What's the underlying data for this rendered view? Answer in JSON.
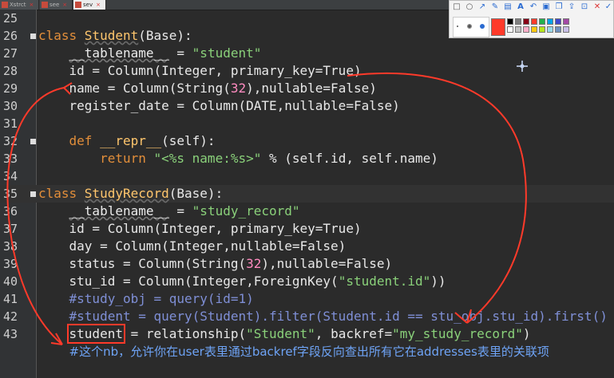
{
  "tabs": [
    {
      "label": "Xstrct"
    },
    {
      "label": "see"
    },
    {
      "label": "sev"
    }
  ],
  "lines": [
    {
      "n": "25",
      "tokens": []
    },
    {
      "n": "26",
      "fold": true,
      "tokens": [
        [
          "kw",
          "class "
        ],
        [
          "cls under",
          "Student"
        ],
        [
          "w",
          "(Base):"
        ]
      ]
    },
    {
      "n": "27",
      "tokens": [
        [
          "w",
          "    "
        ],
        [
          "tbl",
          "__tablename__"
        ],
        [
          "w",
          " = "
        ],
        [
          "str",
          "\"student\""
        ]
      ]
    },
    {
      "n": "28",
      "tokens": [
        [
          "w",
          "    id = Column(Integer, primary_key=True)"
        ]
      ]
    },
    {
      "n": "29",
      "tokens": [
        [
          "w",
          "    name = Column(String("
        ],
        [
          "num32",
          "32"
        ],
        [
          "w",
          "),nullable=False)"
        ]
      ]
    },
    {
      "n": "30",
      "tokens": [
        [
          "w",
          "    register_date = Column(DATE,nullable=False)"
        ]
      ]
    },
    {
      "n": "31",
      "tokens": []
    },
    {
      "n": "32",
      "fold": true,
      "tokens": [
        [
          "w",
          "    "
        ],
        [
          "kw",
          "def "
        ],
        [
          "cls",
          "__repr__"
        ],
        [
          "w",
          "(self):"
        ]
      ]
    },
    {
      "n": "33",
      "tokens": [
        [
          "w",
          "        "
        ],
        [
          "kw",
          "return "
        ],
        [
          "str",
          "\"<%s name:%s>\""
        ],
        [
          "w",
          " % (self.id, self.name)"
        ]
      ]
    },
    {
      "n": "34",
      "tokens": []
    },
    {
      "n": "35",
      "fold": true,
      "hl": true,
      "tokens": [
        [
          "kw",
          "class "
        ],
        [
          "cls under",
          "StudyRecord"
        ],
        [
          "w",
          "(Base):"
        ]
      ]
    },
    {
      "n": "36",
      "tokens": [
        [
          "w",
          "    "
        ],
        [
          "tbl",
          "__tablename__"
        ],
        [
          "w",
          " = "
        ],
        [
          "str",
          "\"study_record\""
        ]
      ]
    },
    {
      "n": "37",
      "tokens": [
        [
          "w",
          "    id = Column(Integer, primary_key=True)"
        ]
      ]
    },
    {
      "n": "38",
      "tokens": [
        [
          "w",
          "    day = Column(Integer,nullable=False)"
        ]
      ]
    },
    {
      "n": "39",
      "tokens": [
        [
          "w",
          "    status = Column(String("
        ],
        [
          "num32",
          "32"
        ],
        [
          "w",
          "),nullable=False)"
        ]
      ]
    },
    {
      "n": "40",
      "tokens": [
        [
          "w",
          "    stu_id = Column(Integer,ForeignKey("
        ],
        [
          "str",
          "\"student.id\""
        ],
        [
          "w",
          "))"
        ]
      ]
    },
    {
      "n": "41",
      "tokens": [
        [
          "w",
          "    "
        ],
        [
          "com",
          "#study_obj = query(id=1)"
        ]
      ]
    },
    {
      "n": "42",
      "tokens": [
        [
          "w",
          "    "
        ],
        [
          "com",
          "#student = query(Student).filter(Student.id == stu_obj.stu_id).first()"
        ]
      ]
    },
    {
      "n": "43",
      "tokens": [
        [
          "w",
          "    "
        ],
        [
          "w box",
          "student"
        ],
        [
          "w",
          " = relationship("
        ],
        [
          "str",
          "\"Student\""
        ],
        [
          "w",
          ", backref="
        ],
        [
          "str",
          "\"my_study_record\""
        ],
        [
          "w",
          ")"
        ]
      ]
    },
    {
      "n": "",
      "tokens": [
        [
          "w",
          "    "
        ],
        [
          "com chinese",
          "#这个nb，允许你在user表里通过backref字段反向查出所有它在addresses表里的关联项"
        ]
      ]
    }
  ],
  "colors": {
    "bg": "#2b2b2b",
    "keyword": "#e28e3a",
    "string": "#8ad17a",
    "comment": "#7f8fd6",
    "annotation": "#ff3a2a"
  },
  "toolbar": {
    "icons": [
      "rect-icon",
      "circle-icon",
      "arrow-icon",
      "pen-icon",
      "marker-icon",
      "text-icon",
      "undo-icon",
      "save-icon",
      "copy-icon",
      "share-icon",
      "close-icon"
    ],
    "swatches": [
      "#000000",
      "#7f7f7f",
      "#880015",
      "#ff3a2a",
      "#22b14c",
      "#00a2e8",
      "#3f48cc",
      "#a349a4",
      "#ffffff",
      "#c3c3c3",
      "#ffaec9",
      "#ffc90e",
      "#b5e61d",
      "#99d9ea",
      "#7092be",
      "#c8bfe7"
    ],
    "selected_color": "#ff3a2a"
  }
}
